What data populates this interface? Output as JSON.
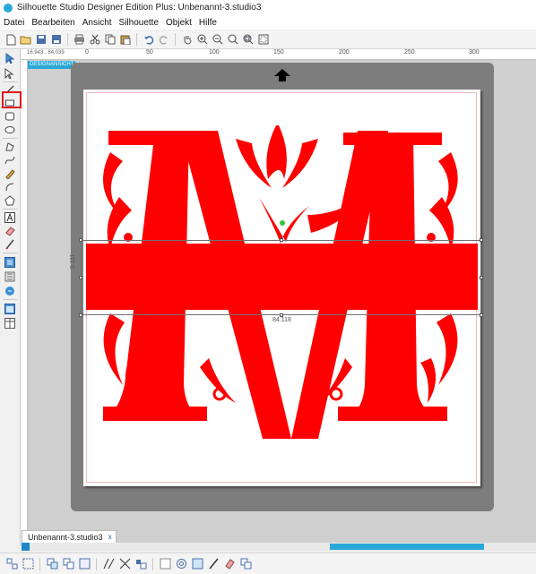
{
  "window": {
    "title": "Silhouette Studio Designer Edition Plus: Unbenannt-3.studio3"
  },
  "menu": [
    "Datei",
    "Bearbeiten",
    "Ansicht",
    "Silhouette",
    "Objekt",
    "Hilfe"
  ],
  "ruler": {
    "readout": "16.943 , 84.039",
    "labels": [
      "0",
      "50",
      "100",
      "150",
      "200",
      "250",
      "300"
    ]
  },
  "canvas": {
    "view_label": "DESIGNANSICHT",
    "selection_width": "84.118",
    "selection_height": "5.111"
  },
  "tabs": [
    {
      "label": "Unbenannt-3.studio3",
      "close": "x"
    }
  ],
  "colors": {
    "accent": "#28a8d8",
    "design": "#ff0000",
    "highlight": "#e01818",
    "mat": "#7d7d7d",
    "selection_handle": "#3cc43c"
  },
  "toolbar_icons": [
    "new-icon",
    "open-icon",
    "save-icon",
    "save-as-icon",
    "print-icon",
    "cut-icon",
    "copy-icon",
    "paste-icon",
    "undo-icon",
    "redo-icon",
    "hand-icon",
    "zoom-in-icon",
    "zoom-out-icon",
    "zoom-drag-icon",
    "zoom-fit-icon",
    "zoom-page-icon"
  ],
  "left_tool_icons": [
    "select-icon",
    "point-edit-icon",
    "line-icon",
    "rectangle-icon",
    "rounded-rectangle-icon",
    "ellipse-icon",
    "polygon-icon",
    "curve-icon",
    "freehand-icon",
    "arc-icon",
    "regular-polygon-icon",
    "text-icon",
    "eraser-icon",
    "knife-icon",
    "grid-icon",
    "library-icon",
    "store-icon",
    "single-pane-icon",
    "split-pane-icon"
  ],
  "bottom_tool_icons": [
    "group-icon",
    "ungroup-icon",
    "compound-icon",
    "release-compound-icon",
    "bring-front-icon",
    "send-back-icon",
    "weld-icon",
    "offset-icon",
    "trace-icon",
    "replicate-icon",
    "nest-icon",
    "knife-tool-icon",
    "eraser-tool-icon",
    "duplicate-icon"
  ]
}
